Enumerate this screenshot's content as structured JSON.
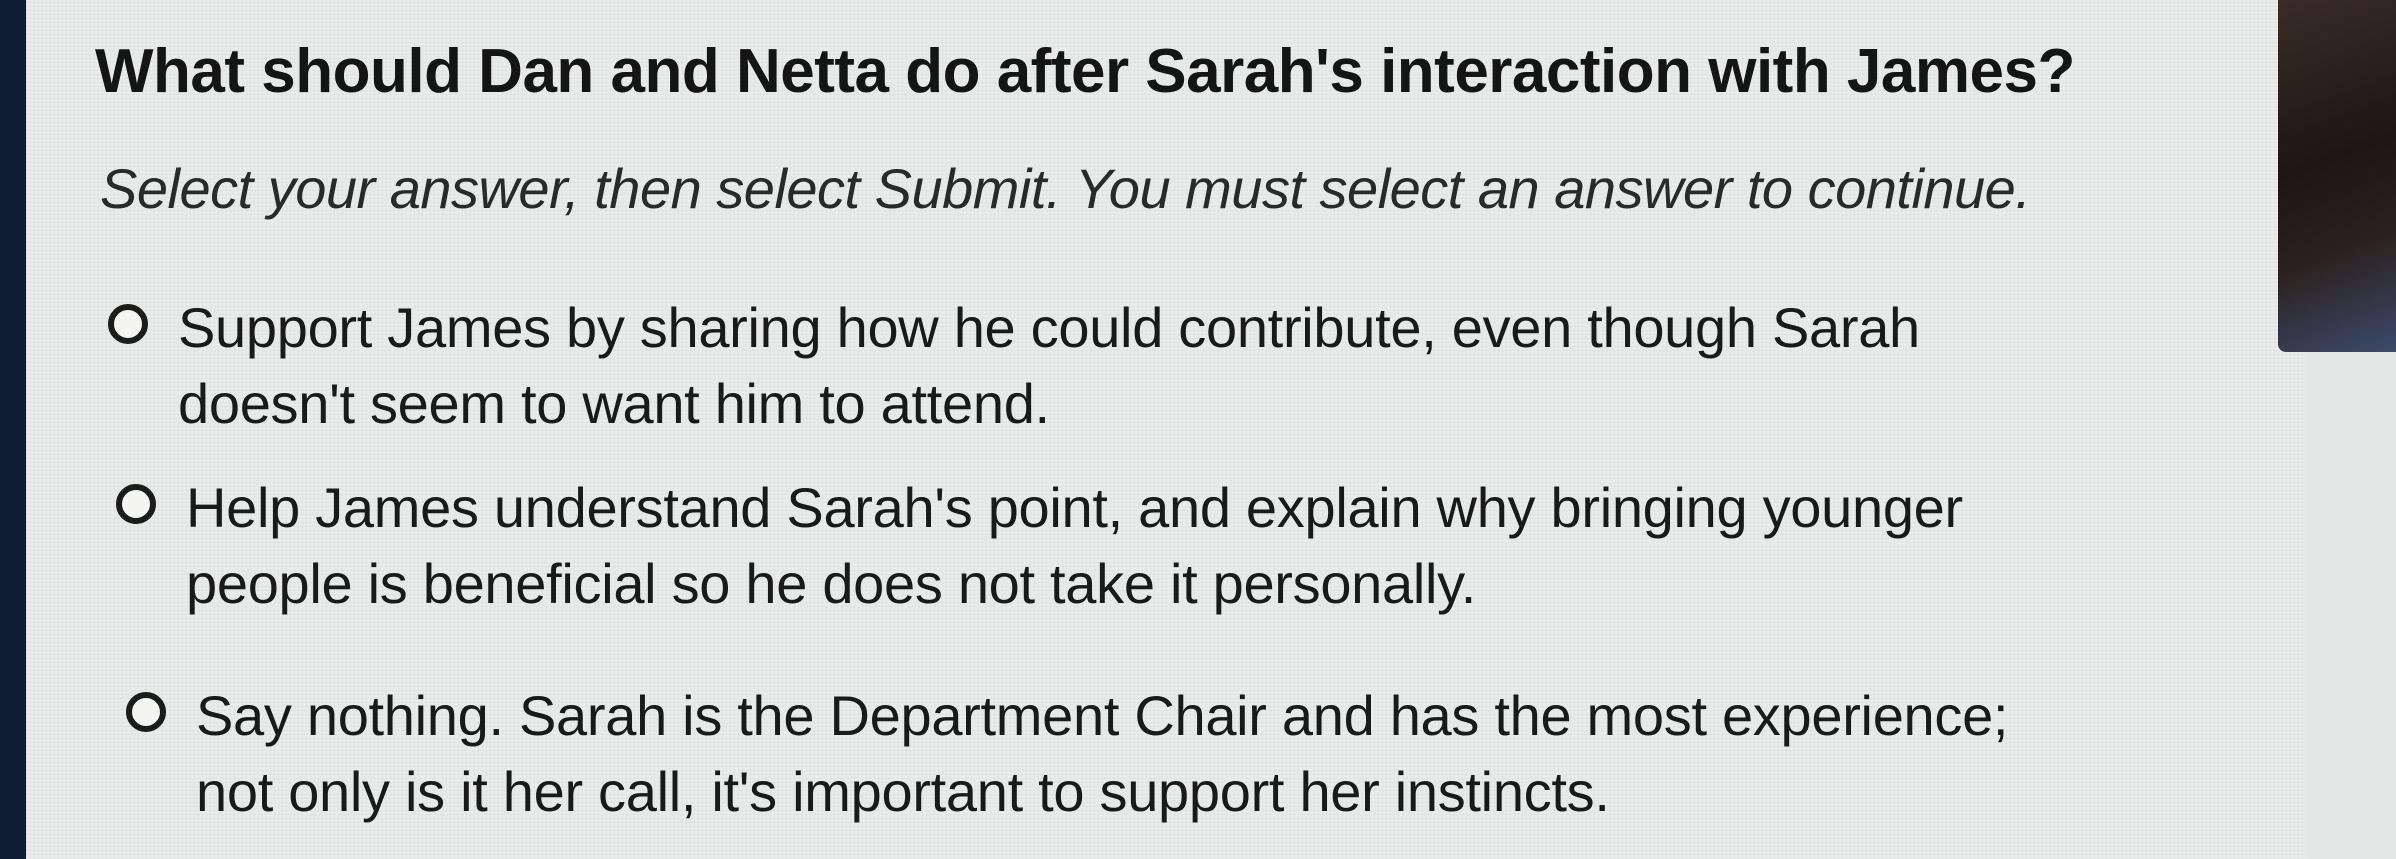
{
  "question": {
    "title": "What should Dan and Netta do after Sarah's interaction with James?",
    "instruction": "Select your answer, then select Submit. You must select an answer to continue."
  },
  "options": [
    {
      "label": "Support James by sharing how he could contribute, even though Sarah doesn't seem to want him to attend.",
      "selected": false
    },
    {
      "label": "Help James understand Sarah's point, and explain why bringing younger people is beneficial so he does not take it personally.",
      "selected": false
    },
    {
      "label": "Say nothing. Sarah is the Department Chair and has the most experience; not only is it her call, it's important to support her instincts.",
      "selected": false
    }
  ],
  "colors": {
    "background": "#e9ebea",
    "text": "#151515",
    "frame": "#0f1d35"
  }
}
